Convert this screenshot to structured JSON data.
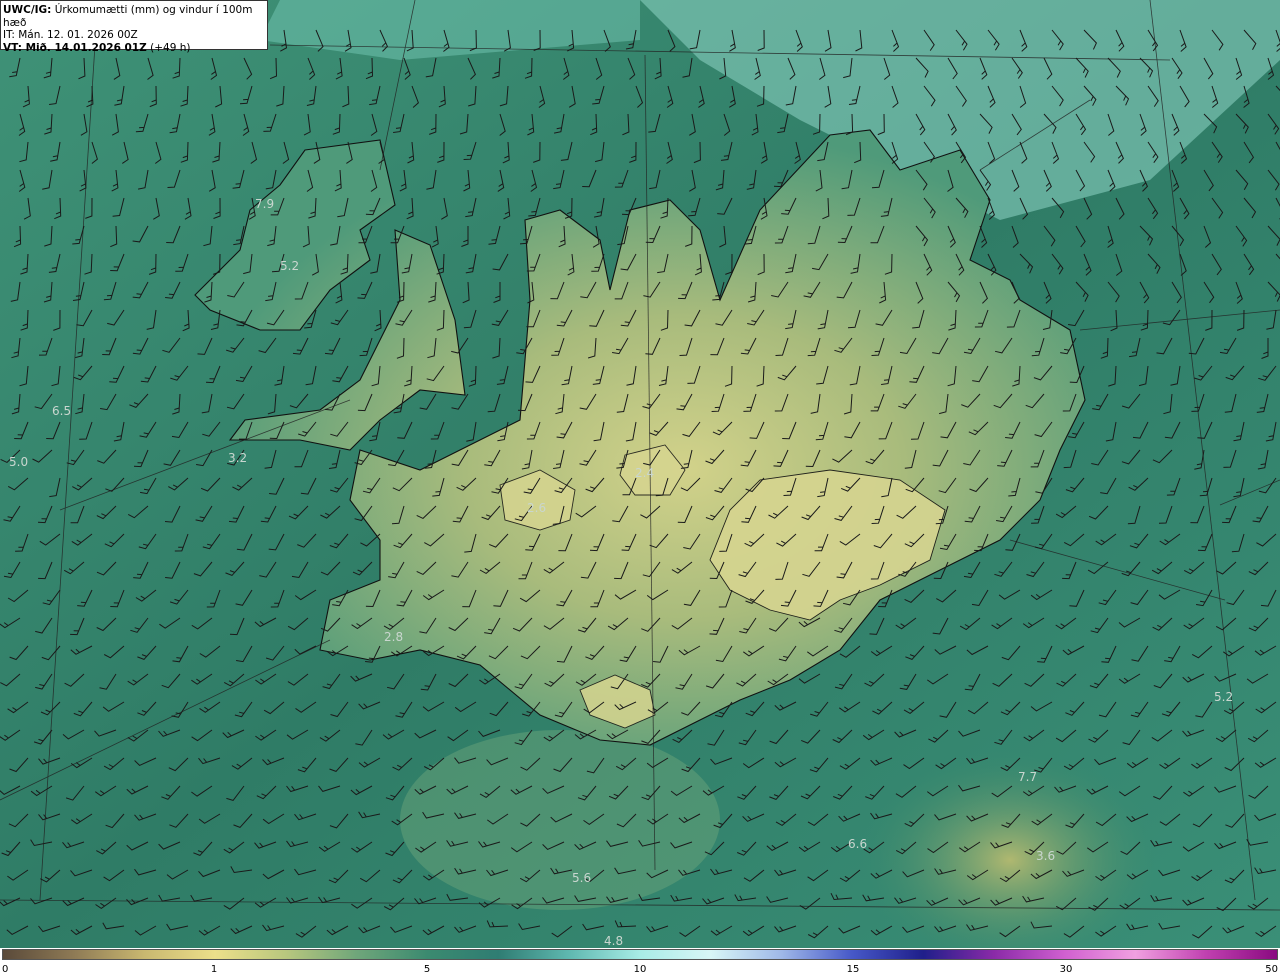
{
  "header": {
    "model_label": "UWC/IG:",
    "product": "Úrkomumætti (mm) og vindur í 100m hæð",
    "issue_time": "IT: Mán. 12. 01. 2026 00Z",
    "valid_label": "VT: Mið. 14.01.2026 01Z",
    "lead_time": "(+49 h)"
  },
  "colors": {
    "background_low": "#2e7a66",
    "background_mid": "#4a9a80",
    "land_high": "#c9cf85",
    "sea_light": "#9fe0d8",
    "coast": "#111111"
  },
  "map_values": [
    {
      "text": "7.9"
    },
    {
      "text": "5.2"
    },
    {
      "text": "6.5"
    },
    {
      "text": "5.0"
    },
    {
      "text": "3.2"
    },
    {
      "text": "2.6"
    },
    {
      "text": "2.4"
    },
    {
      "text": "2.8"
    },
    {
      "text": "5.2"
    },
    {
      "text": "7.7"
    },
    {
      "text": "6.6"
    },
    {
      "text": "3.6"
    },
    {
      "text": "5.6"
    },
    {
      "text": "4.8"
    }
  ],
  "colorbar": {
    "ticks": [
      "0",
      "1",
      "5",
      "10",
      "15",
      "30",
      "50"
    ],
    "stops": [
      "#5a4a3a",
      "#8e7a55",
      "#c9b870",
      "#ecdf8a",
      "#b8c77e",
      "#6fa67a",
      "#3b8a70",
      "#2f7d73",
      "#5fb8b0",
      "#a8ece6",
      "#d8f6f6",
      "#9fb8e8",
      "#4658c8",
      "#1f1f8a",
      "#8a2aa8",
      "#d060d0",
      "#f0a0e0",
      "#c040b0",
      "#8a0a80"
    ]
  }
}
